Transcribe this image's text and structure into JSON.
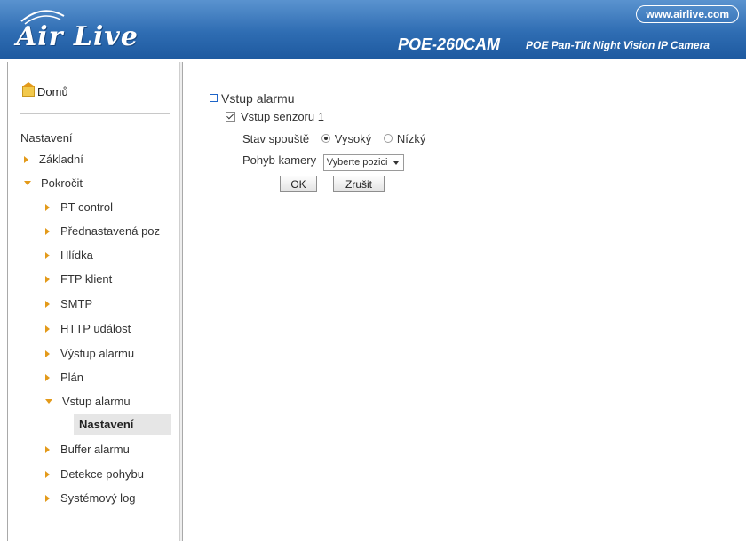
{
  "header": {
    "logo_text": "Air Live",
    "site_url": "www.airlive.com",
    "model": "POE-260CAM",
    "model_description": "POE Pan-Tilt Night Vision IP Camera"
  },
  "sidebar": {
    "home_label": "Domů",
    "section_label": "Nastavení",
    "items": {
      "zakladni": "Základní",
      "pokrocit": "Pokročit",
      "pt_control": "PT control",
      "prednastavena": "Přednastavená poz",
      "hlidka": "Hlídka",
      "ftp": "FTP klient",
      "smtp": "SMTP",
      "http": "HTTP událost",
      "vystup": "Výstup alarmu",
      "plan": "Plán",
      "vstup": "Vstup alarmu",
      "nastaveni_active": "Nastavení",
      "buffer": "Buffer alarmu",
      "detekce": "Detekce pohybu",
      "log": "Systémový log"
    }
  },
  "main": {
    "section_title": "Vstup alarmu",
    "sensor_label": "Vstup senzoru 1",
    "sensor_checked": true,
    "trigger_label": "Stav spouště",
    "trigger_options": [
      "Vysoký",
      "Nízký"
    ],
    "trigger_selected": "Vysoký",
    "camera_move_label": "Pohyb kamery",
    "camera_move_value": "Vyberte pozici",
    "ok_label": "OK",
    "cancel_label": "Zrušit"
  },
  "colors": {
    "header_blue": "#2f6db3",
    "accent_orange": "#e39a1a"
  }
}
